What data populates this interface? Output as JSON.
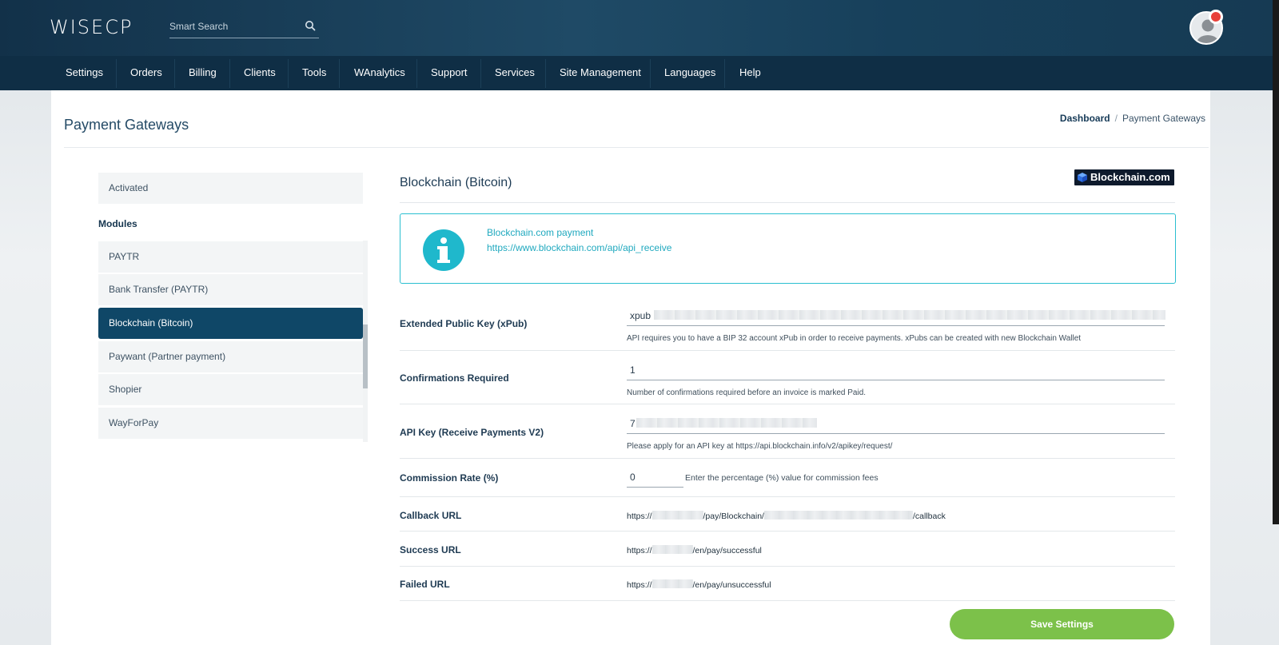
{
  "app": {
    "logo": "WISECP",
    "search_placeholder": "Smart Search"
  },
  "nav": {
    "items": [
      "Settings",
      "Orders",
      "Billing",
      "Clients",
      "Tools",
      "WAnalytics",
      "Support",
      "Services",
      "Site Management",
      "Languages",
      "Help"
    ]
  },
  "page": {
    "title": "Payment Gateways",
    "breadcrumb": {
      "home": "Dashboard",
      "separator": "/",
      "current": "Payment Gateways"
    }
  },
  "sidebar": {
    "activated_label": "Activated",
    "modules_label": "Modules",
    "items": [
      "PAYTR",
      "Bank Transfer (PAYTR)",
      "Blockchain (Bitcoin)",
      "Paywant (Partner payment)",
      "Shopier",
      "WayForPay"
    ],
    "active_item": "Blockchain (Bitcoin)"
  },
  "gateway": {
    "title": "Blockchain (Bitcoin)",
    "logo_text": "Blockchain.com",
    "info": {
      "line1": "Blockchain.com payment",
      "line2": "https://www.blockchain.com/api/api_receive"
    },
    "fields": {
      "xpub": {
        "label": "Extended Public Key (xPub)",
        "value": "xpub",
        "help": "API requires you to have a BIP 32 account xPub in order to receive payments. xPubs can be created with new Blockchain Wallet"
      },
      "confirmations": {
        "label": "Confirmations Required",
        "value": "1",
        "help": "Number of confirmations required before an invoice is marked Paid."
      },
      "api_key": {
        "label": "API Key (Receive Payments V2)",
        "value": "7",
        "help": "Please apply for an API key at https://api.blockchain.info/v2/apikey/request/"
      },
      "commission": {
        "label": "Commission Rate (%)",
        "value": "0",
        "help": "Enter the percentage (%) value for commission fees"
      },
      "callback": {
        "label": "Callback URL",
        "prefix": "https://",
        "middle": "/pay/Blockchain/",
        "suffix": "/callback"
      },
      "success": {
        "label": "Success URL",
        "prefix": "https://",
        "suffix": "/en/pay/successful"
      },
      "failed": {
        "label": "Failed URL",
        "prefix": "https://",
        "suffix": "/en/pay/unsuccessful"
      }
    },
    "save_label": "Save Settings"
  },
  "colors": {
    "header": "#123149",
    "nav": "#0f2e45",
    "active_item": "#0f4767",
    "info_accent": "#20a9bf",
    "save_button": "#7cc14a",
    "notification": "#e8403a"
  }
}
